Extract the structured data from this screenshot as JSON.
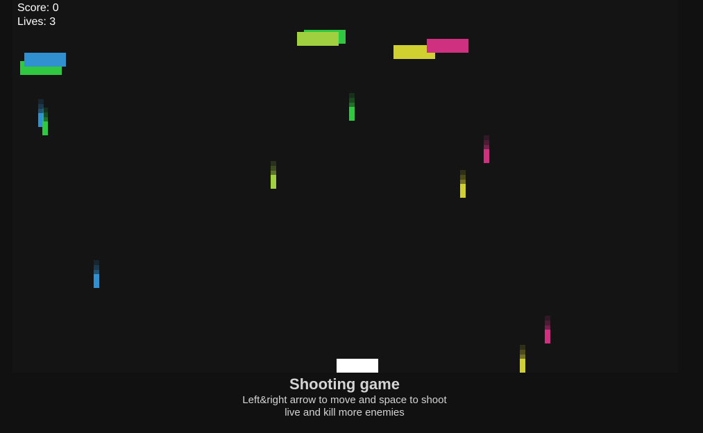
{
  "hud": {
    "score_label": "Score:",
    "score": 0,
    "lives_label": "Lives:",
    "lives": 3
  },
  "info": {
    "title": "Shooting game",
    "instructions": "Left&right arrow to move and space to shoot",
    "goal": "live and kill more enemies"
  },
  "colors": {
    "page_background": "#111111",
    "canvas_background": "#141414",
    "player": "#ffffff",
    "hud_text": "#ffffff",
    "info_text": "#d4d4d4",
    "blue": "#3090d0",
    "green": "#30c840",
    "lime": "#a0d040",
    "yellow": "#d0d030",
    "pink": "#d03080"
  },
  "enemies": [
    {
      "color": "green"
    },
    {
      "color": "blue"
    },
    {
      "color": "green"
    },
    {
      "color": "lime"
    },
    {
      "color": "yellow"
    },
    {
      "color": "pink"
    }
  ],
  "bullets": [
    {
      "color": "blue"
    },
    {
      "color": "green"
    },
    {
      "color": "green"
    },
    {
      "color": "pink"
    },
    {
      "color": "lime"
    },
    {
      "color": "yellow"
    },
    {
      "color": "blue"
    },
    {
      "color": "pink"
    },
    {
      "color": "yellow"
    }
  ]
}
